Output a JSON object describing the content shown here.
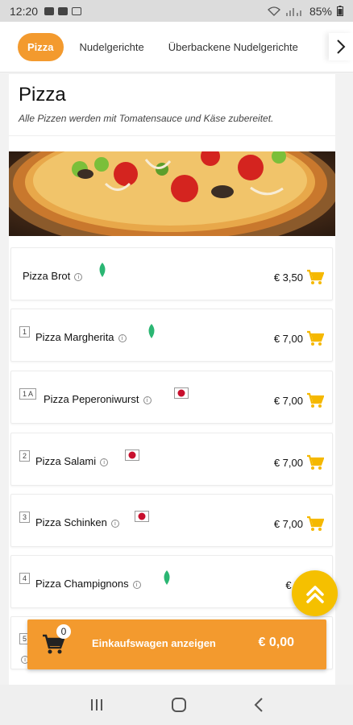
{
  "status": {
    "time": "12:20",
    "battery": "85%"
  },
  "tabs": [
    {
      "label": "Pizza",
      "active": true
    },
    {
      "label": "Nudelgerichte",
      "active": false
    },
    {
      "label": "Überbackene Nudelgerichte",
      "active": false
    }
  ],
  "section": {
    "title": "Pizza",
    "description": "Alle Pizzen werden mit Tomatensauce und Käse zubereitet."
  },
  "items": [
    {
      "num": "",
      "name": "Pizza Brot",
      "price": "€ 3,50",
      "tag": "leaf-icon"
    },
    {
      "num": "1",
      "name": "Pizza Margherita",
      "price": "€ 7,00",
      "tag": "leaf-icon"
    },
    {
      "num": "1 A",
      "name": "Pizza Peperoniwurst",
      "price": "€ 7,00",
      "tag": "meat-icon"
    },
    {
      "num": "2",
      "name": "Pizza Salami",
      "price": "€ 7,00",
      "tag": "meat-icon"
    },
    {
      "num": "3",
      "name": "Pizza Schinken",
      "price": "€ 7,00",
      "tag": "meat-icon"
    },
    {
      "num": "4",
      "name": "Pizza Champignons",
      "price": "€ 7,",
      "tag": "leaf-icon"
    },
    {
      "num": "5",
      "name": "",
      "price": "",
      "tag": ""
    }
  ],
  "cart": {
    "count": "0",
    "label": "Einkaufswagen anzeigen",
    "total": "€ 0,00"
  },
  "colors": {
    "accent": "#f39a2e",
    "fab": "#f5c000",
    "cart_icon": "#f5c000",
    "leaf": "#2bb673",
    "meat": "#c8102e"
  }
}
